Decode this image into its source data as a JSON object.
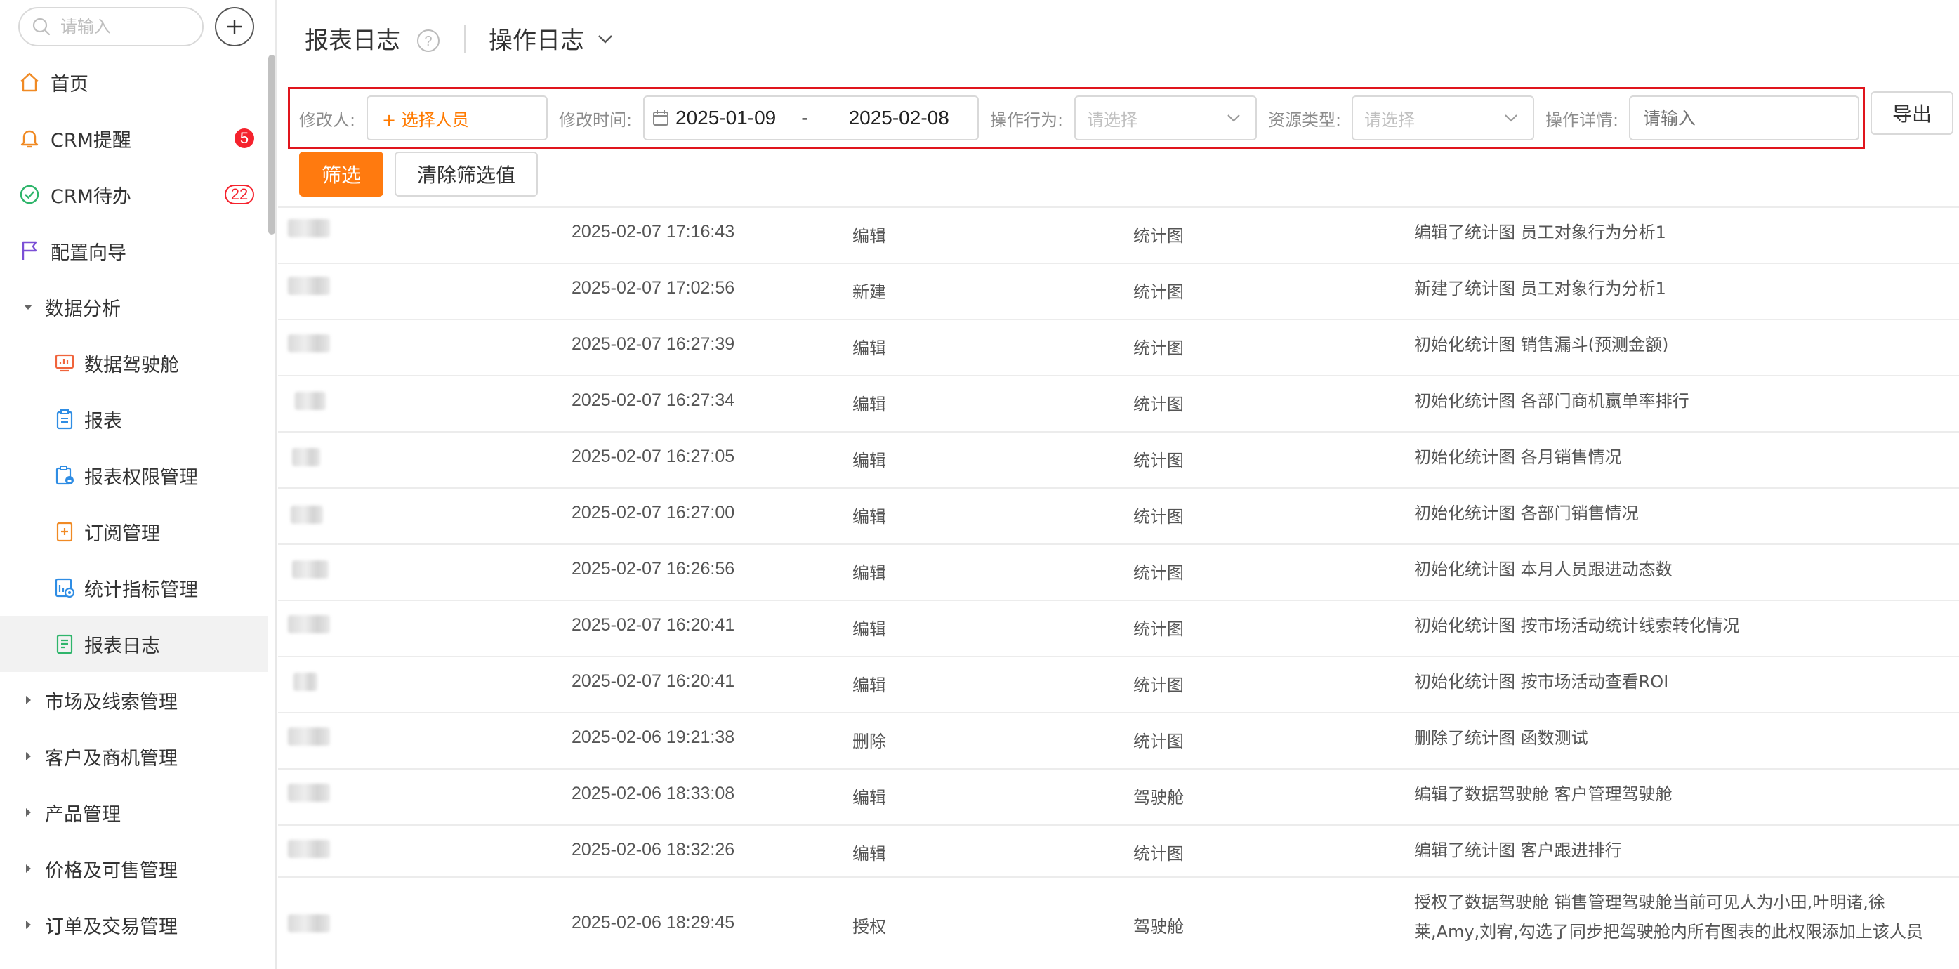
{
  "sidebar": {
    "search_placeholder": "请输入",
    "items": [
      {
        "label": "首页"
      },
      {
        "label": "CRM提醒",
        "badge": "5"
      },
      {
        "label": "CRM待办",
        "badge": "22"
      },
      {
        "label": "配置向导"
      },
      {
        "label": "数据分析"
      },
      {
        "label": "数据驾驶舱"
      },
      {
        "label": "报表"
      },
      {
        "label": "报表权限管理"
      },
      {
        "label": "订阅管理"
      },
      {
        "label": "统计指标管理"
      },
      {
        "label": "报表日志"
      },
      {
        "label": "市场及线索管理"
      },
      {
        "label": "客户及商机管理"
      },
      {
        "label": "产品管理"
      },
      {
        "label": "价格及可售管理"
      },
      {
        "label": "订单及交易管理"
      }
    ],
    "icons": [
      "home-icon",
      "bell-icon",
      "check-circle-icon",
      "flag-icon",
      "caret-down-icon",
      "dashboard-icon",
      "clipboard-icon",
      "clipboard-lock-icon",
      "subscribe-icon",
      "metrics-icon",
      "log-icon",
      "caret-right-icon"
    ]
  },
  "header": {
    "title": "报表日志",
    "dropdown_label": "操作日志"
  },
  "filters": {
    "modifier_label": "修改人:",
    "modifier_value": "+ 选择人员",
    "time_label": "修改时间:",
    "date_start": "2025-01-09",
    "date_sep": "-",
    "date_end": "2025-02-08",
    "action_label": "操作行为:",
    "action_placeholder": "请选择",
    "resource_label": "资源类型:",
    "resource_placeholder": "请选择",
    "detail_label": "操作详情:",
    "detail_placeholder": "请输入",
    "export_label": "导出",
    "filter_label": "筛选",
    "clear_label": "清除筛选值"
  },
  "table": {
    "rows": [
      {
        "time": "2025-02-07 17:16:43",
        "action": "编辑",
        "resource": "统计图",
        "detail": "编辑了统计图 员工对象行为分析1"
      },
      {
        "time": "2025-02-07 17:02:56",
        "action": "新建",
        "resource": "统计图",
        "detail": "新建了统计图 员工对象行为分析1"
      },
      {
        "time": "2025-02-07 16:27:39",
        "action": "编辑",
        "resource": "统计图",
        "detail": "初始化统计图 销售漏斗(预测金额)"
      },
      {
        "time": "2025-02-07 16:27:34",
        "action": "编辑",
        "resource": "统计图",
        "detail": "初始化统计图 各部门商机赢单率排行"
      },
      {
        "time": "2025-02-07 16:27:05",
        "action": "编辑",
        "resource": "统计图",
        "detail": "初始化统计图 各月销售情况"
      },
      {
        "time": "2025-02-07 16:27:00",
        "action": "编辑",
        "resource": "统计图",
        "detail": "初始化统计图 各部门销售情况"
      },
      {
        "time": "2025-02-07 16:26:56",
        "action": "编辑",
        "resource": "统计图",
        "detail": "初始化统计图 本月人员跟进动态数"
      },
      {
        "time": "2025-02-07 16:20:41",
        "action": "编辑",
        "resource": "统计图",
        "detail": "初始化统计图 按市场活动统计线索转化情况"
      },
      {
        "time": "2025-02-07 16:20:41",
        "action": "编辑",
        "resource": "统计图",
        "detail": "初始化统计图 按市场活动查看ROI"
      },
      {
        "time": "2025-02-06 19:21:38",
        "action": "删除",
        "resource": "统计图",
        "detail": "删除了统计图 函数测试"
      },
      {
        "time": "2025-02-06 18:33:08",
        "action": "编辑",
        "resource": "驾驶舱",
        "detail": "编辑了数据驾驶舱 客户管理驾驶舱"
      },
      {
        "time": "2025-02-06 18:32:26",
        "action": "编辑",
        "resource": "统计图",
        "detail": "编辑了统计图 客户跟进排行"
      },
      {
        "time": "2025-02-06 18:29:45",
        "action": "授权",
        "resource": "驾驶舱",
        "detail": "授权了数据驾驶舱 销售管理驾驶舱当前可见人为小田,叶明诸,徐莱,Amy,刘宥,勾选了同步把驾驶舱内所有图表的此权限添加上该人员"
      }
    ]
  },
  "colors": {
    "accent": "#ff7a0f",
    "highlight": "#e0151d",
    "badge": "#f5222d"
  }
}
